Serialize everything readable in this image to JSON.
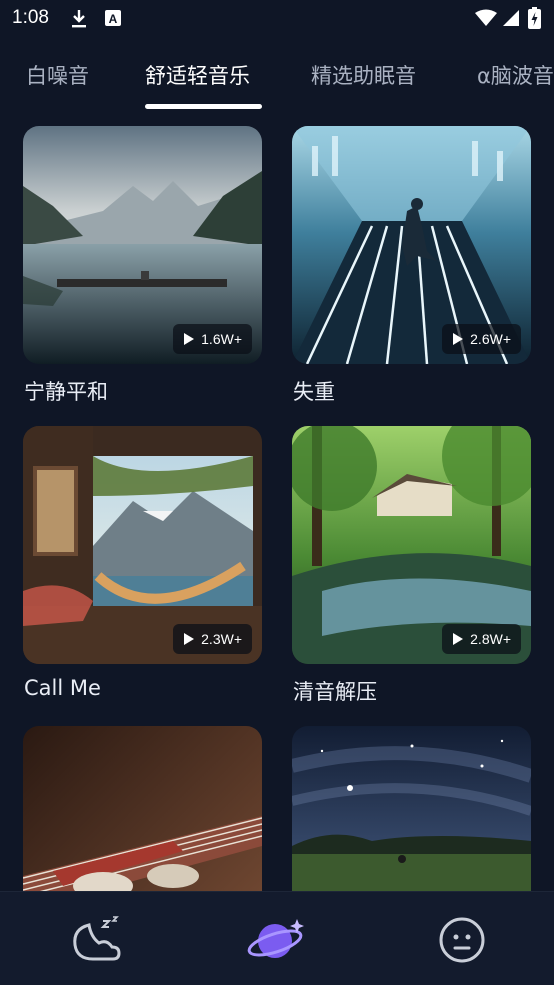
{
  "status_bar": {
    "time": "1:08",
    "icons": [
      "download-icon",
      "a-notification-icon",
      "wifi-icon",
      "signal-icon",
      "battery-charging-icon"
    ]
  },
  "tabs": [
    {
      "label": "白噪音",
      "active": false
    },
    {
      "label": "舒适轻音乐",
      "active": true
    },
    {
      "label": "精选助眠音",
      "active": false
    },
    {
      "label": "α脑波音",
      "active": false
    }
  ],
  "cards": [
    {
      "title": "宁静平和",
      "plays": "1.6W+"
    },
    {
      "title": "失重",
      "plays": "2.6W+"
    },
    {
      "title": "Call Me",
      "plays": "2.3W+"
    },
    {
      "title": "清音解压",
      "plays": "2.8W+"
    },
    {
      "title": "",
      "plays": ""
    },
    {
      "title": "",
      "plays": ""
    }
  ],
  "bottom_nav": [
    {
      "icon": "moon-sleep-icon",
      "active": false
    },
    {
      "icon": "planet-icon",
      "active": true
    },
    {
      "icon": "smiley-face-icon",
      "active": false
    }
  ],
  "colors": {
    "background": "#0f1626",
    "nav_background": "#131b2d",
    "accent_purple": "#7b5cf0",
    "inactive_tab": "#aab2c2"
  }
}
